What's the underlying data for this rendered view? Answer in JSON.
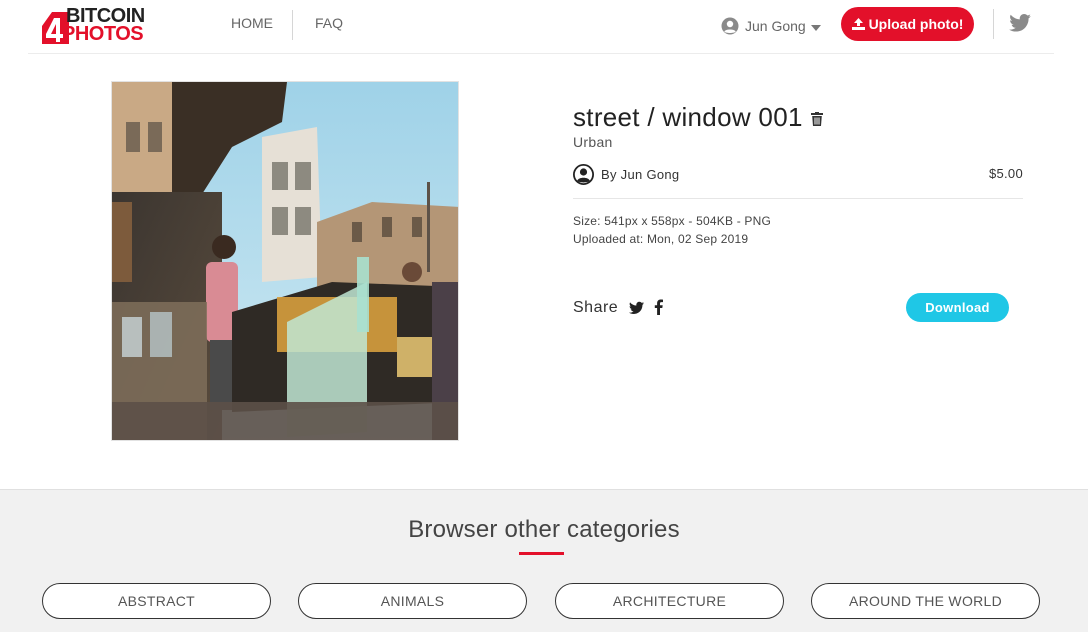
{
  "header": {
    "logo_top": "BITCOIN",
    "logo_bottom": "PHOTOS",
    "nav_home": "HOME",
    "nav_faq": "FAQ",
    "user_name": "Jun Gong",
    "upload_label": "Upload photo!"
  },
  "photo": {
    "title": "street / window 001",
    "category": "Urban",
    "author": "By Jun Gong",
    "price": "$5.00",
    "size_info": "Size: 541px x 558px - 504KB - PNG",
    "uploaded": "Uploaded at: Mon, 02 Sep 2019",
    "share_label": "Share",
    "download_label": "Download"
  },
  "categories": {
    "heading": "Browser other categories",
    "items": [
      "ABSTRACT",
      "ANIMALS",
      "ARCHITECTURE",
      "AROUND THE WORLD"
    ]
  },
  "colors": {
    "brand_red": "#e3102a",
    "download_cyan": "#1fc7e6"
  },
  "icons": [
    "user-avatar-icon",
    "caret-down-icon",
    "upload-icon",
    "twitter-icon",
    "trash-icon",
    "facebook-icon"
  ]
}
